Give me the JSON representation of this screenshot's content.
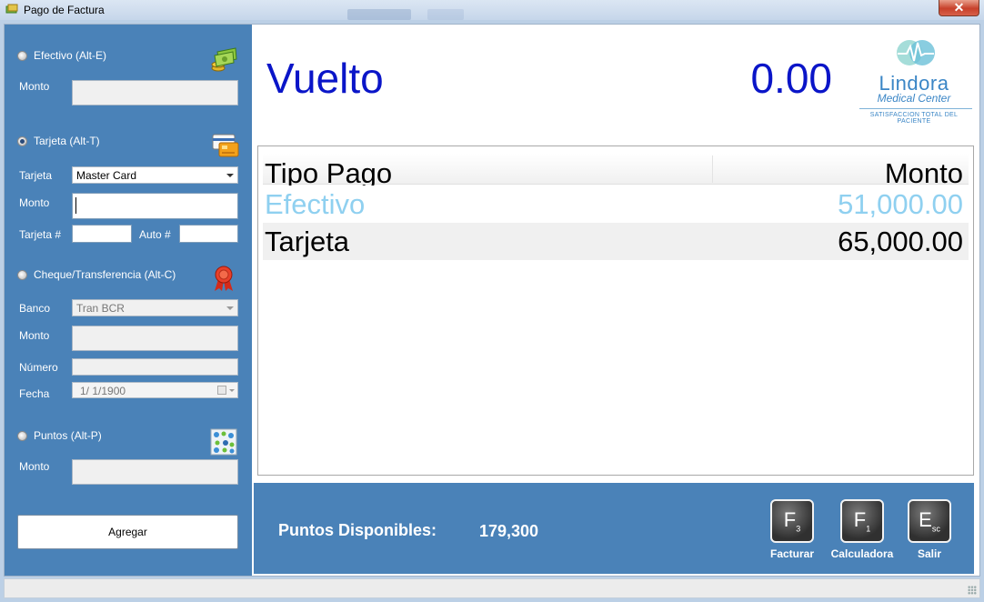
{
  "window": {
    "title": "Pago de Factura",
    "close_glyph": "✕"
  },
  "left": {
    "efectivo": {
      "radio_label": "Efectivo (Alt-E)",
      "monto_label": "Monto",
      "monto_value": "",
      "icon": "cash-icon",
      "checked": false
    },
    "tarjeta": {
      "radio_label": "Tarjeta (Alt-T)",
      "checked": true,
      "icon": "credit-card-icon",
      "tarjeta_label": "Tarjeta",
      "tarjeta_value": "Master Card",
      "monto_label": "Monto",
      "monto_value": "",
      "num_label": "Tarjeta #",
      "num_value": "",
      "auto_label": "Auto #",
      "auto_value": ""
    },
    "cheque": {
      "radio_label": "Cheque/Transferencia (Alt-C)",
      "checked": false,
      "icon": "ribbon-icon",
      "banco_label": "Banco",
      "banco_value": "Tran BCR",
      "monto_label": "Monto",
      "monto_value": "",
      "numero_label": "Número",
      "numero_value": "",
      "fecha_label": "Fecha",
      "fecha_value": "1/  1/1900"
    },
    "puntos": {
      "radio_label": "Puntos (Alt-P)",
      "checked": false,
      "icon": "network-icon",
      "monto_label": "Monto",
      "monto_value": ""
    },
    "agregar_label": "Agregar"
  },
  "header": {
    "vuelto_label": "Vuelto",
    "vuelto_value": "0.00"
  },
  "logo": {
    "name": "Lindora",
    "subtitle": "Medical Center",
    "tagline": "SATISFACCION TOTAL DEL PACIENTE"
  },
  "grid": {
    "columns": [
      "Tipo Pago",
      "Monto"
    ],
    "rows": [
      {
        "tipo": "Efectivo",
        "monto": "51,000.00"
      },
      {
        "tipo": "Tarjeta",
        "monto": "65,000.00"
      }
    ]
  },
  "footer": {
    "puntos_label": "Puntos Disponibles:",
    "puntos_value": "179,300",
    "keys": [
      {
        "key": "F",
        "sub": "3",
        "caption": "Facturar"
      },
      {
        "key": "F",
        "sub": "1",
        "caption": "Calculadora"
      },
      {
        "key": "E",
        "sub": "sc",
        "caption": "Salir"
      }
    ]
  },
  "colors": {
    "panel": "#4a82b8",
    "vuelto": "#0a15c8",
    "selected_row_text": "#8fd0f0"
  }
}
